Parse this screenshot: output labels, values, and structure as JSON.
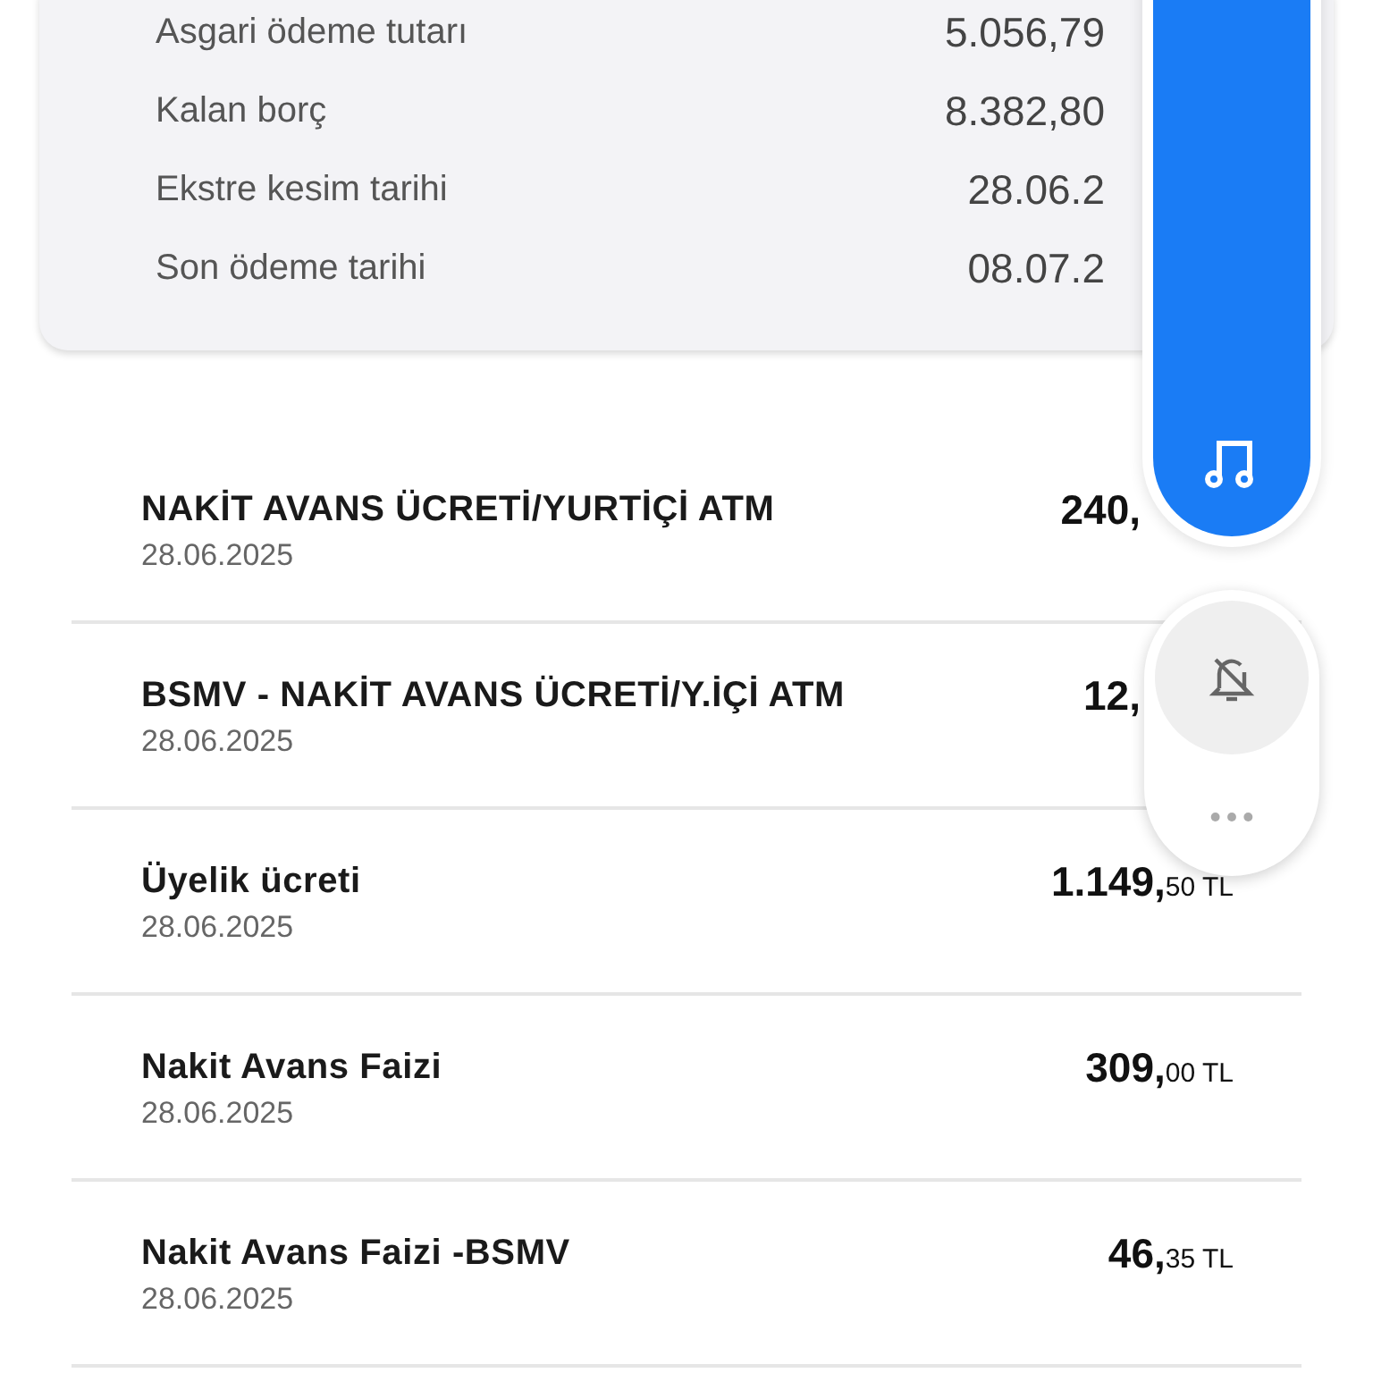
{
  "summary": [
    {
      "label": "Asgari ödeme tutarı",
      "value": "5.056,79"
    },
    {
      "label": "Kalan borç",
      "value": "8.382,80"
    },
    {
      "label": "Ekstre kesim tarihi",
      "value": "28.06.2"
    },
    {
      "label": "Son ödeme tarihi",
      "value": "08.07.2"
    }
  ],
  "transactions": [
    {
      "title": "NAKİT AVANS ÜCRETİ/YURTİÇİ ATM",
      "date": "28.06.2025",
      "amount": "240,",
      "kind": "cut"
    },
    {
      "title": "BSMV - NAKİT AVANS ÜCRETİ/Y.İÇİ ATM",
      "date": "28.06.2025",
      "amount": "12,",
      "kind": "cut"
    },
    {
      "title": "Üyelik ücreti",
      "date": "28.06.2025",
      "amount": "1.149,",
      "fraction": "50",
      "currency": "TL",
      "kind": "full"
    },
    {
      "title": "Nakit Avans Faizi",
      "date": "28.06.2025",
      "amount": "309,",
      "fraction": "00",
      "currency": "TL",
      "kind": "full"
    },
    {
      "title": "Nakit Avans Faizi -BSMV",
      "date": "28.06.2025",
      "amount": "46,",
      "fraction": "35",
      "currency": "TL",
      "kind": "full"
    }
  ]
}
